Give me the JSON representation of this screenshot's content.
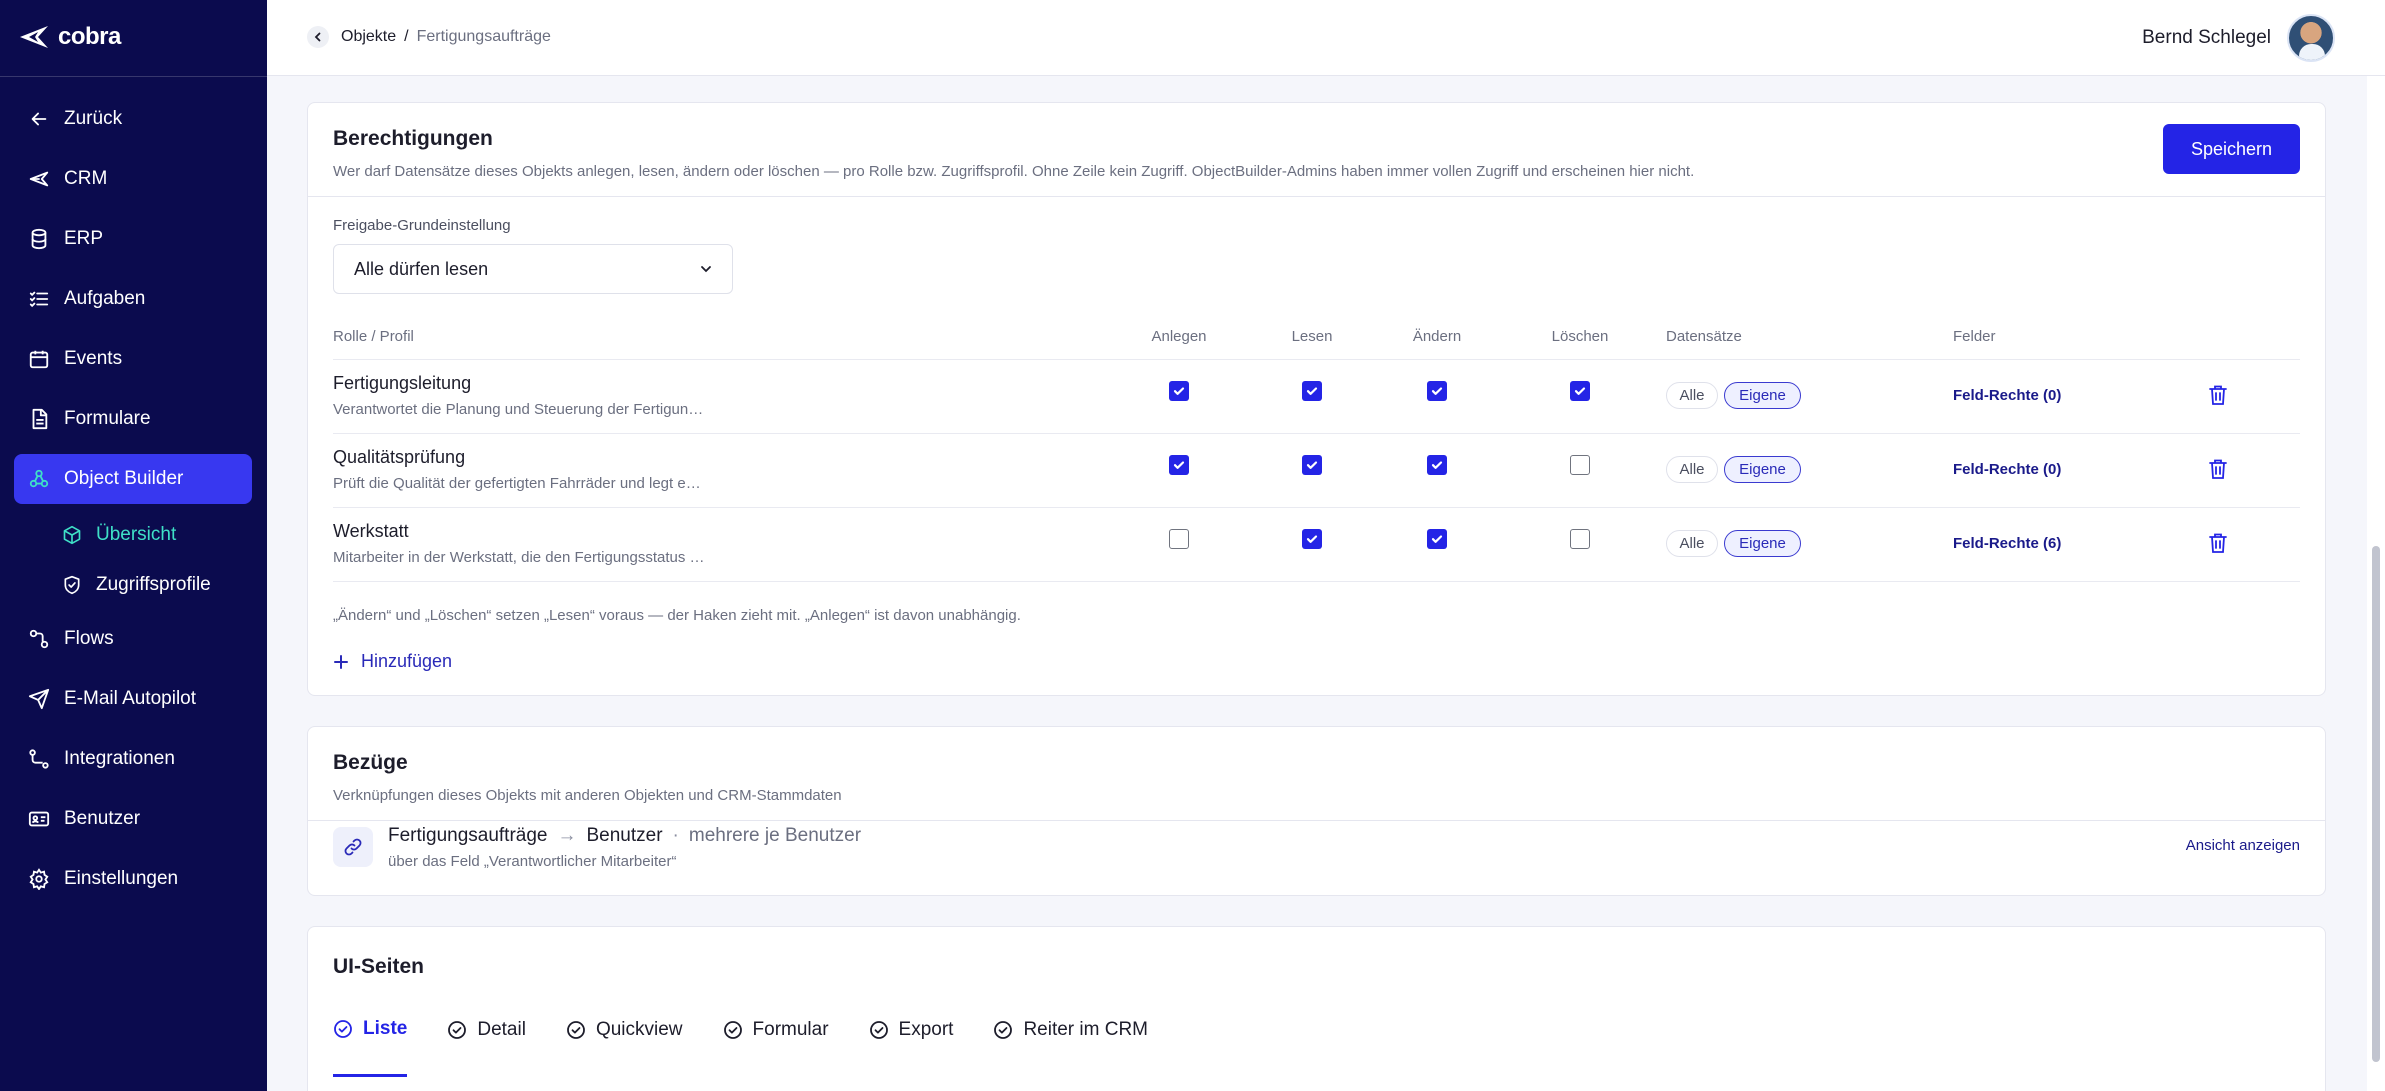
{
  "app": {
    "logo_text": "cobra"
  },
  "sidebar": {
    "items": [
      {
        "label": "Zurück",
        "icon": "arrow-left-icon"
      },
      {
        "label": "CRM",
        "icon": "crm-icon"
      },
      {
        "label": "ERP",
        "icon": "database-icon"
      },
      {
        "label": "Aufgaben",
        "icon": "tasks-icon"
      },
      {
        "label": "Events",
        "icon": "calendar-icon"
      },
      {
        "label": "Formulare",
        "icon": "form-icon"
      },
      {
        "label": "Object Builder",
        "icon": "object-builder-icon",
        "active": true
      },
      {
        "label": "Flows",
        "icon": "flows-icon"
      },
      {
        "label": "E-Mail Autopilot",
        "icon": "send-icon"
      },
      {
        "label": "Integrationen",
        "icon": "integrations-icon"
      },
      {
        "label": "Benutzer",
        "icon": "user-card-icon"
      },
      {
        "label": "Einstellungen",
        "icon": "gear-icon"
      }
    ],
    "subitems": [
      {
        "label": "Übersicht",
        "icon": "cube-icon",
        "current": true
      },
      {
        "label": "Zugriffsprofile",
        "icon": "shield-icon"
      }
    ]
  },
  "header": {
    "breadcrumb": {
      "parent": "Objekte",
      "separator": "/",
      "current": "Fertigungsaufträge"
    },
    "user_name": "Bernd Schlegel"
  },
  "permissions": {
    "title": "Berechtigungen",
    "subtitle": "Wer darf Datensätze dieses Objekts anlegen, lesen, ändern oder löschen — pro Rolle bzw. Zugriffsprofil. Ohne Zeile kein Zugriff. ObjectBuilder-Admins haben immer vollen Zugriff und erscheinen hier nicht.",
    "save_label": "Speichern",
    "default_label": "Freigabe-Grundeinstellung",
    "default_value": "Alle dürfen lesen",
    "columns": {
      "role": "Rolle / Profil",
      "create": "Anlegen",
      "read": "Lesen",
      "update": "Ändern",
      "delete": "Löschen",
      "records": "Datensätze",
      "fields": "Felder"
    },
    "rows": [
      {
        "name": "Fertigungsleitung",
        "description": "Verantwortet die Planung und Steuerung der Fertigun…",
        "create": true,
        "read": true,
        "update": true,
        "delete": true,
        "scope_all": "Alle",
        "scope_own": "Eigene",
        "selected_scope": "Eigene",
        "fields_link": "Feld-Rechte (0)"
      },
      {
        "name": "Qualitätsprüfung",
        "description": "Prüft die Qualität der gefertigten Fahrräder und legt e…",
        "create": true,
        "read": true,
        "update": true,
        "delete": false,
        "scope_all": "Alle",
        "scope_own": "Eigene",
        "selected_scope": "Eigene",
        "fields_link": "Feld-Rechte (0)"
      },
      {
        "name": "Werkstatt",
        "description": "Mitarbeiter in der Werkstatt, die den Fertigungsstatus …",
        "create": false,
        "read": true,
        "update": true,
        "delete": false,
        "scope_all": "Alle",
        "scope_own": "Eigene",
        "selected_scope": "Eigene",
        "fields_link": "Feld-Rechte (6)"
      }
    ],
    "note": "„Ändern“ und „Löschen“ setzen „Lesen“ voraus — der Haken zieht mit. „Anlegen“ ist davon unabhängig.",
    "add_label": "Hinzufügen"
  },
  "relations": {
    "title": "Bezüge",
    "subtitle": "Verknüpfungen dieses Objekts mit anderen Objekten und CRM-Stammdaten",
    "items": [
      {
        "source": "Fertigungsaufträge",
        "arrow": "→",
        "target": "Benutzer",
        "dot": "·",
        "cardinality": "mehrere je Benutzer",
        "via": "über das Feld „Verantwortlicher Mitarbeiter“",
        "link": "Ansicht anzeigen"
      }
    ]
  },
  "ui_pages": {
    "title": "UI-Seiten",
    "tabs": [
      {
        "label": "Liste",
        "active": true
      },
      {
        "label": "Detail"
      },
      {
        "label": "Quickview"
      },
      {
        "label": "Formular"
      },
      {
        "label": "Export"
      },
      {
        "label": "Reiter im CRM"
      }
    ]
  },
  "colors": {
    "sidebar_bg": "#0b0b4e",
    "accent": "#2424e6",
    "active_nav": "#3838f0",
    "current_subitem": "#3fe0c7"
  }
}
